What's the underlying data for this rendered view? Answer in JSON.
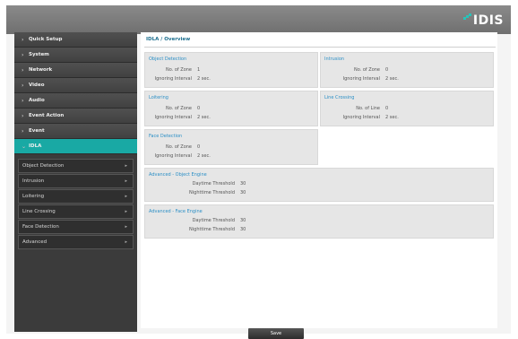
{
  "brand": {
    "logo_text": "IDIS",
    "accent": "#19a9a4"
  },
  "sidebar": {
    "items": [
      {
        "label": "Quick Setup"
      },
      {
        "label": "System"
      },
      {
        "label": "Network"
      },
      {
        "label": "Video"
      },
      {
        "label": "Audio"
      },
      {
        "label": "Event Action"
      },
      {
        "label": "Event"
      },
      {
        "label": "IDLA"
      }
    ],
    "sub_items": [
      {
        "label": "Object Detection"
      },
      {
        "label": "Intrusion"
      },
      {
        "label": "Loitering"
      },
      {
        "label": "Line Crossing"
      },
      {
        "label": "Face Detection"
      },
      {
        "label": "Advanced"
      }
    ]
  },
  "main": {
    "breadcrumb": "IDLA / Overview",
    "panels": {
      "object_detection": {
        "title": "Object Detection",
        "rows": [
          {
            "k": "No. of Zone",
            "v": "1"
          },
          {
            "k": "Ignoring Interval",
            "v": "2 sec."
          }
        ]
      },
      "intrusion": {
        "title": "Intrusion",
        "rows": [
          {
            "k": "No. of Zone",
            "v": "0"
          },
          {
            "k": "Ignoring Interval",
            "v": "2 sec."
          }
        ]
      },
      "loitering": {
        "title": "Loitering",
        "rows": [
          {
            "k": "No. of Zone",
            "v": "0"
          },
          {
            "k": "Ignoring Interval",
            "v": "2 sec."
          }
        ]
      },
      "line_crossing": {
        "title": "Line Crossing",
        "rows": [
          {
            "k": "No. of Line",
            "v": "0"
          },
          {
            "k": "Ignoring Interval",
            "v": "2 sec."
          }
        ]
      },
      "face_detection": {
        "title": "Face Detection",
        "rows": [
          {
            "k": "No. of Zone",
            "v": "0"
          },
          {
            "k": "Ignoring Interval",
            "v": "2 sec."
          }
        ]
      },
      "adv_object": {
        "title": "Advanced - Object Engine",
        "rows": [
          {
            "k": "Daytime Threshold",
            "v": "30"
          },
          {
            "k": "Nighttime Threshold",
            "v": "30"
          }
        ]
      },
      "adv_face": {
        "title": "Advanced - Face Engine",
        "rows": [
          {
            "k": "Daytime Threshold",
            "v": "30"
          },
          {
            "k": "Nighttime Threshold",
            "v": "30"
          }
        ]
      }
    },
    "save_label": "Save"
  }
}
